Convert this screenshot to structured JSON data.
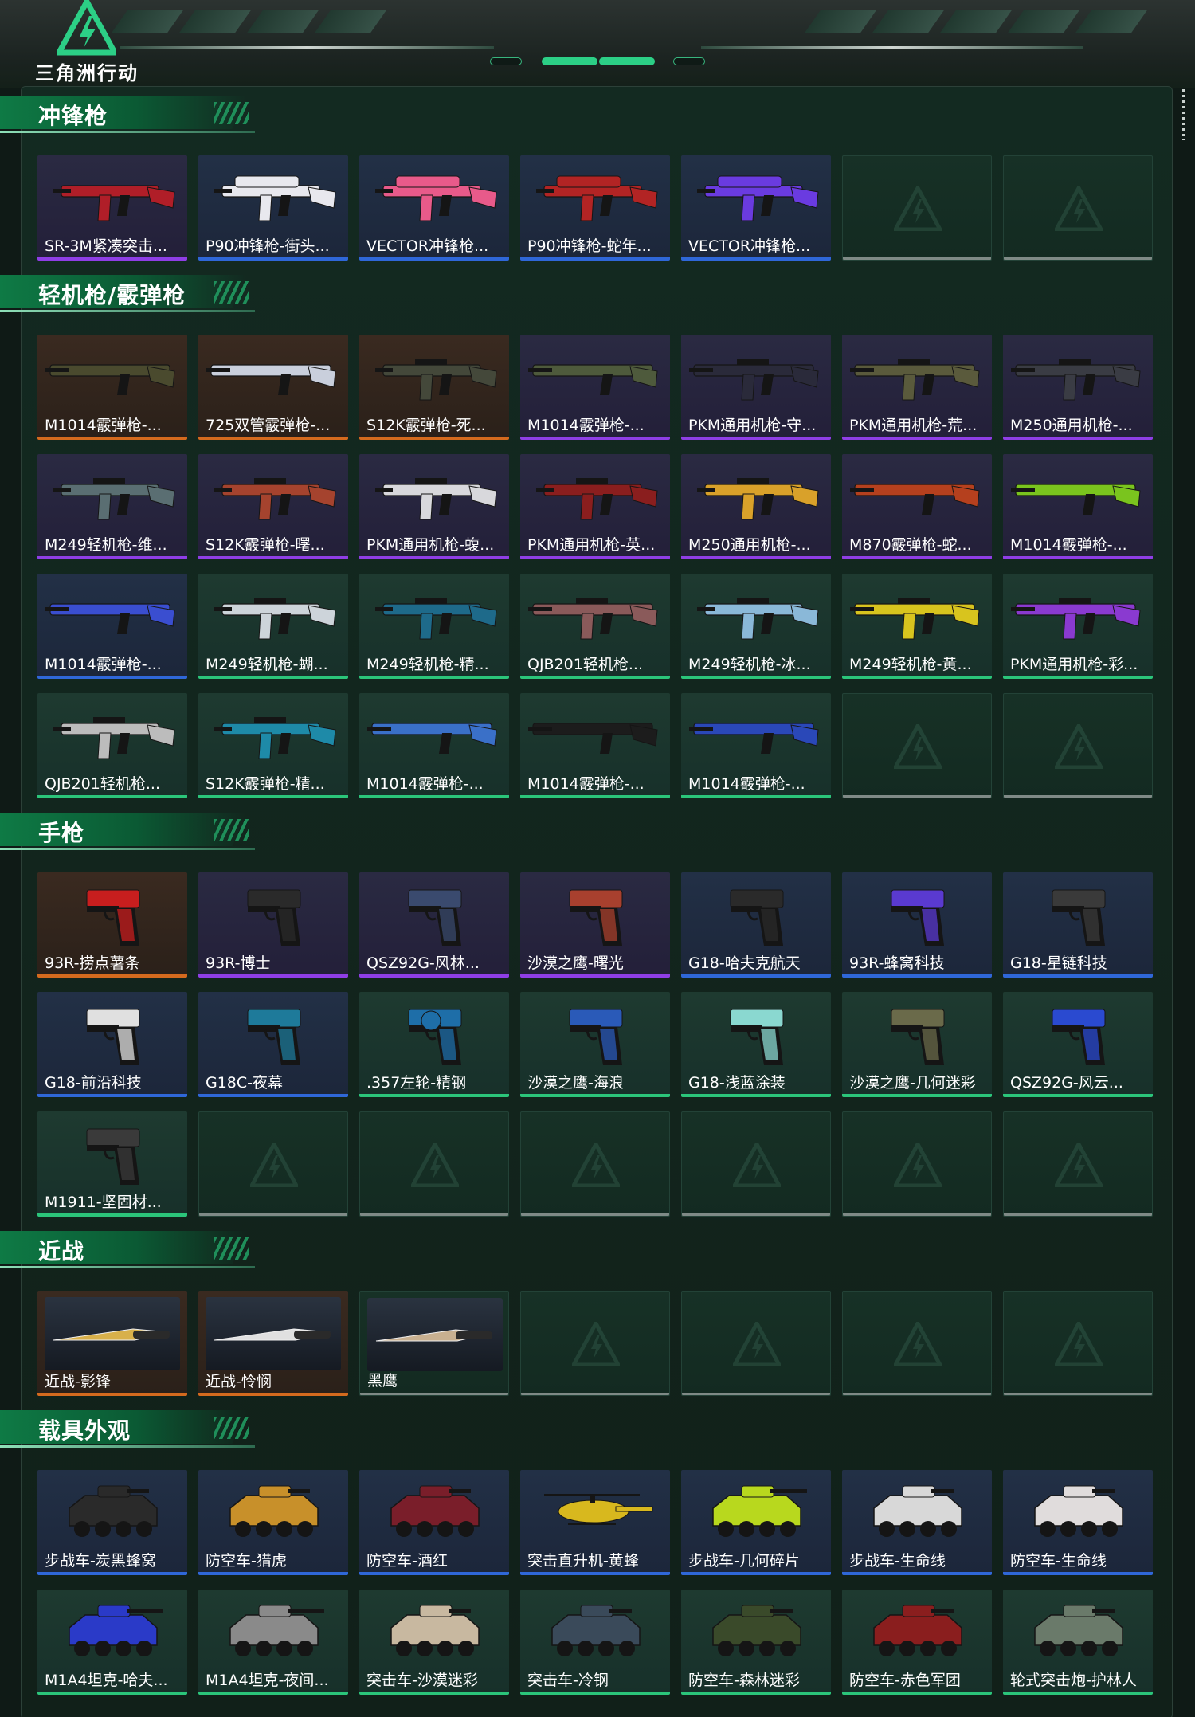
{
  "header": {
    "logo_text": "三角洲行动",
    "logo_icon": "delta-force-triangle-logo"
  },
  "colors": {
    "accent": "#2ccf86",
    "rarity_purple": "#8f3ee6",
    "rarity_orange": "#d46a1e",
    "rarity_blue": "#2f67d8",
    "rarity_green": "#2bc57a",
    "rarity_empty": "#7f8a86"
  },
  "sections": [
    {
      "title": "冲锋枪",
      "items": [
        {
          "label": "SR-3M紧凑突击...",
          "rarity": "purple",
          "kind": "smg",
          "tint": "#b01e28"
        },
        {
          "label": "P90冲锋枪-街头...",
          "rarity": "blue",
          "kind": "p90",
          "tint": "#e8e8ee"
        },
        {
          "label": "VECTOR冲锋枪...",
          "rarity": "blue",
          "kind": "vector",
          "tint": "#e85a8a"
        },
        {
          "label": "P90冲锋枪-蛇年...",
          "rarity": "blue",
          "kind": "p90",
          "tint": "#b22424"
        },
        {
          "label": "VECTOR冲锋枪...",
          "rarity": "blue",
          "kind": "vector",
          "tint": "#6a3be0"
        },
        {
          "label": "",
          "rarity": "empty"
        },
        {
          "label": "",
          "rarity": "empty"
        }
      ]
    },
    {
      "title": "轻机枪/霰弹枪",
      "items": [
        {
          "label": "M1014霰弹枪-...",
          "rarity": "orange",
          "kind": "shotgun",
          "tint": "#4a4a2e"
        },
        {
          "label": "725双管霰弹枪-...",
          "rarity": "orange",
          "kind": "shotgun",
          "tint": "#c9cfdc"
        },
        {
          "label": "S12K霰弹枪-死...",
          "rarity": "orange",
          "kind": "rifle",
          "tint": "#44483a"
        },
        {
          "label": "M1014霰弹枪-...",
          "rarity": "purple",
          "kind": "shotgun",
          "tint": "#4e5a3c"
        },
        {
          "label": "PKM通用机枪-守...",
          "rarity": "purple",
          "kind": "lmg",
          "tint": "#2a2a3a"
        },
        {
          "label": "PKM通用机枪-荒...",
          "rarity": "purple",
          "kind": "lmg",
          "tint": "#5a5a3c"
        },
        {
          "label": "M250通用机枪-...",
          "rarity": "purple",
          "kind": "lmg",
          "tint": "#3a3c44"
        },
        {
          "label": "M249轻机枪-维...",
          "rarity": "purple",
          "kind": "rifle",
          "tint": "#5a6e72"
        },
        {
          "label": "S12K霰弹枪-曙...",
          "rarity": "purple",
          "kind": "rifle",
          "tint": "#a5432e"
        },
        {
          "label": "PKM通用机枪-蝮...",
          "rarity": "purple",
          "kind": "rifle",
          "tint": "#d8d8dc"
        },
        {
          "label": "PKM通用机枪-英...",
          "rarity": "purple",
          "kind": "rifle",
          "tint": "#8a1e1e"
        },
        {
          "label": "M250通用机枪-...",
          "rarity": "purple",
          "kind": "rifle",
          "tint": "#d9a12a"
        },
        {
          "label": "M870霰弹枪-蛇...",
          "rarity": "purple",
          "kind": "shotgun",
          "tint": "#b5401e"
        },
        {
          "label": "M1014霰弹枪-...",
          "rarity": "purple",
          "kind": "shotgun",
          "tint": "#7ac41e"
        },
        {
          "label": "M1014霰弹枪-...",
          "rarity": "blue",
          "kind": "shotgun",
          "tint": "#3a4ed0"
        },
        {
          "label": "M249轻机枪-蝴...",
          "rarity": "green",
          "kind": "rifle",
          "tint": "#cdd4da"
        },
        {
          "label": "M249轻机枪-精...",
          "rarity": "green",
          "kind": "rifle",
          "tint": "#1e6a8a"
        },
        {
          "label": "QJB201轻机枪...",
          "rarity": "green",
          "kind": "lmg",
          "tint": "#8a5a5a"
        },
        {
          "label": "M249轻机枪-冰...",
          "rarity": "green",
          "kind": "rifle",
          "tint": "#8ab8d8"
        },
        {
          "label": "M249轻机枪-黄...",
          "rarity": "green",
          "kind": "lmg",
          "tint": "#d8c41e"
        },
        {
          "label": "PKM通用机枪-彩...",
          "rarity": "green",
          "kind": "lmg",
          "tint": "#8a3ad0"
        },
        {
          "label": "QJB201轻机枪...",
          "rarity": "green",
          "kind": "rifle",
          "tint": "#bcbcbc"
        },
        {
          "label": "S12K霰弹枪-精...",
          "rarity": "green",
          "kind": "rifle",
          "tint": "#1e8aa8"
        },
        {
          "label": "M1014霰弹枪-...",
          "rarity": "green",
          "kind": "shotgun",
          "tint": "#3a70c8"
        },
        {
          "label": "M1014霰弹枪-...",
          "rarity": "green",
          "kind": "shotgun",
          "tint": "#1c1c1c"
        },
        {
          "label": "M1014霰弹枪-...",
          "rarity": "green",
          "kind": "shotgun",
          "tint": "#2a48b8"
        },
        {
          "label": "",
          "rarity": "empty"
        },
        {
          "label": "",
          "rarity": "empty"
        }
      ]
    },
    {
      "title": "手枪",
      "items": [
        {
          "label": "93R-捞点薯条",
          "rarity": "orange",
          "kind": "pistol",
          "tint": "#c81e1e"
        },
        {
          "label": "93R-博士",
          "rarity": "purple",
          "kind": "pistol",
          "tint": "#2a2a2a"
        },
        {
          "label": "QSZ92G-风林...",
          "rarity": "purple",
          "kind": "pistol",
          "tint": "#3a4a6e"
        },
        {
          "label": "沙漠之鹰-曙光",
          "rarity": "purple",
          "kind": "pistol",
          "tint": "#a8402e"
        },
        {
          "label": "G18-哈夫克航天",
          "rarity": "blue",
          "kind": "pistol",
          "tint": "#2a2a2a"
        },
        {
          "label": "93R-蜂窝科技",
          "rarity": "blue",
          "kind": "pistol",
          "tint": "#5a3ad0"
        },
        {
          "label": "G18-星链科技",
          "rarity": "blue",
          "kind": "pistol",
          "tint": "#3a3a3a"
        },
        {
          "label": "G18-前沿科技",
          "rarity": "blue",
          "kind": "pistol",
          "tint": "#e0e0e0"
        },
        {
          "label": "G18C-夜幕",
          "rarity": "blue",
          "kind": "pistol",
          "tint": "#1e7a9a"
        },
        {
          "label": ".357左轮-精钢",
          "rarity": "green",
          "kind": "revolver",
          "tint": "#1e6ea8"
        },
        {
          "label": "沙漠之鹰-海浪",
          "rarity": "green",
          "kind": "pistol",
          "tint": "#2a5ab8"
        },
        {
          "label": "G18-浅蓝涂装",
          "rarity": "green",
          "kind": "pistol",
          "tint": "#8ad8d0"
        },
        {
          "label": "沙漠之鹰-几何迷彩",
          "rarity": "green",
          "kind": "pistol",
          "tint": "#6a6a4a"
        },
        {
          "label": "QSZ92G-风云...",
          "rarity": "green",
          "kind": "pistol",
          "tint": "#2a4ad0"
        },
        {
          "label": "M1911-坚固材...",
          "rarity": "green",
          "kind": "pistol",
          "tint": "#3a3a3a"
        },
        {
          "label": "",
          "rarity": "empty"
        },
        {
          "label": "",
          "rarity": "empty"
        },
        {
          "label": "",
          "rarity": "empty"
        },
        {
          "label": "",
          "rarity": "empty"
        },
        {
          "label": "",
          "rarity": "empty"
        },
        {
          "label": "",
          "rarity": "empty"
        }
      ]
    },
    {
      "title": "近战",
      "items": [
        {
          "label": "近战-影锋",
          "rarity": "orange",
          "kind": "knife",
          "tint": "#d8b04a"
        },
        {
          "label": "近战-怜悯",
          "rarity": "orange",
          "kind": "knife",
          "tint": "#e0e0e0"
        },
        {
          "label": "黑鹰",
          "rarity": "empty-label",
          "kind": "knife",
          "tint": "#c8b090"
        },
        {
          "label": "",
          "rarity": "empty"
        },
        {
          "label": "",
          "rarity": "empty"
        },
        {
          "label": "",
          "rarity": "empty"
        },
        {
          "label": "",
          "rarity": "empty"
        }
      ]
    },
    {
      "title": "载具外观",
      "items": [
        {
          "label": "步战车-炭黑蜂窝",
          "rarity": "blue",
          "kind": "ifv",
          "tint": "#2a2a2a"
        },
        {
          "label": "防空车-猎虎",
          "rarity": "blue",
          "kind": "ifv",
          "tint": "#c8902a"
        },
        {
          "label": "防空车-酒红",
          "rarity": "blue",
          "kind": "ifv",
          "tint": "#7a1e2a"
        },
        {
          "label": "突击直升机-黄蜂",
          "rarity": "blue",
          "kind": "heli",
          "tint": "#d8b81e"
        },
        {
          "label": "步战车-几何碎片",
          "rarity": "blue",
          "kind": "tank",
          "tint": "#b8d81e"
        },
        {
          "label": "步战车-生命线",
          "rarity": "blue",
          "kind": "ifv",
          "tint": "#d8d8d8"
        },
        {
          "label": "防空车-生命线",
          "rarity": "blue",
          "kind": "ifv",
          "tint": "#e0dcdc"
        },
        {
          "label": "M1A4坦克-哈夫...",
          "rarity": "green",
          "kind": "tank",
          "tint": "#2a3ac8"
        },
        {
          "label": "M1A4坦克-夜间...",
          "rarity": "green",
          "kind": "tank",
          "tint": "#8a8a8a"
        },
        {
          "label": "突击车-沙漠迷彩",
          "rarity": "green",
          "kind": "jeep",
          "tint": "#c8b8a0"
        },
        {
          "label": "突击车-冷钢",
          "rarity": "green",
          "kind": "jeep",
          "tint": "#3a4a5a"
        },
        {
          "label": "防空车-森林迷彩",
          "rarity": "green",
          "kind": "ifv",
          "tint": "#3a4a2a"
        },
        {
          "label": "防空车-赤色军团",
          "rarity": "green",
          "kind": "ifv",
          "tint": "#8a1e1e"
        },
        {
          "label": "轮式突击炮-护林人",
          "rarity": "green",
          "kind": "jeep",
          "tint": "#6a7a6a"
        }
      ]
    }
  ]
}
